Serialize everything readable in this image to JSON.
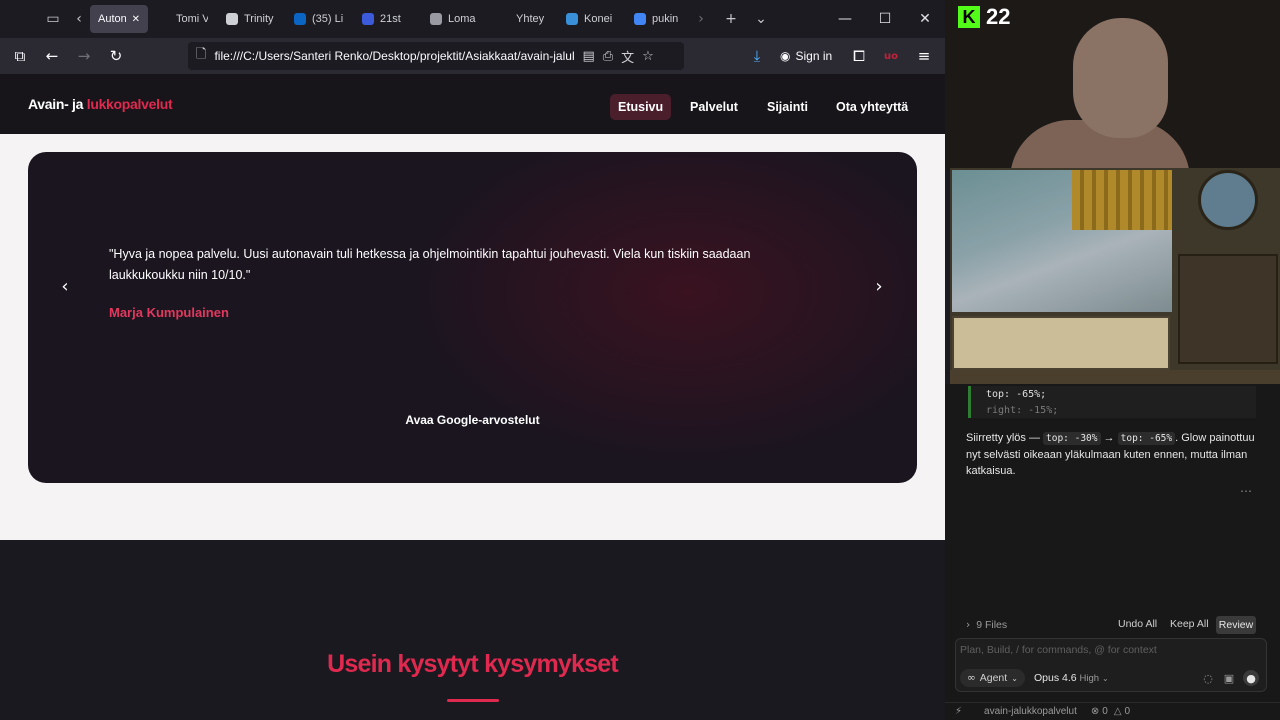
{
  "browser": {
    "tabs": [
      {
        "title": "Auton",
        "active": true,
        "favicon_color": "#6f6f78"
      },
      {
        "title": "Tomi Väli",
        "active": false,
        "favicon_color": "#1c1b22"
      },
      {
        "title": "Trinity",
        "active": false,
        "favicon_color": "#cfcfd6"
      },
      {
        "title": "(35) Li",
        "active": false,
        "favicon_color": "#0a66c2"
      },
      {
        "title": "21st",
        "active": false,
        "favicon_color": "#3b5bdb"
      },
      {
        "title": "Loma",
        "active": false,
        "favicon_color": "#9a9aa3"
      },
      {
        "title": "Yhtey",
        "active": false,
        "favicon_color": "#1c1b22"
      },
      {
        "title": "Konei",
        "active": false,
        "favicon_color": "#3a8fd9"
      },
      {
        "title": "pukin",
        "active": false,
        "favicon_color": "#4285f4"
      }
    ],
    "url": "file:///C:/Users/Santeri Renko/Desktop/projektit/Asiakkaat/avain-jaluk",
    "sign_in_label": "Sign in"
  },
  "site": {
    "logo_prefix": "Avain- ja ",
    "logo_accent": "lukkopalvelut",
    "menu": [
      {
        "label": "Etusivu",
        "active": true
      },
      {
        "label": "Palvelut",
        "active": false
      },
      {
        "label": "Sijainti",
        "active": false
      },
      {
        "label": "Ota yhteyttä",
        "active": false
      }
    ],
    "review": {
      "quote": "\"Hyva ja nopea palvelu. Uusi autonavain tuli hetkessa ja ohjelmointikin tapahtui jouhevasti. Viela kun tiskiin saadaan laukkukoukku niin 10/10.\"",
      "author": "Marja Kumpulainen",
      "google_link": "Avaa Google-arvostelut"
    },
    "faq_title": "Usein kysytyt kysymykset",
    "accent_color": "#e0294f"
  },
  "stream": {
    "kick_logo": "K",
    "viewer_count": "22"
  },
  "editor": {
    "code_lines": [
      "top: -65%;",
      "right: -15%;"
    ],
    "explain_prefix": "Siirretty ylös — ",
    "explain_code_from": "top: -30%",
    "explain_arrow": " → ",
    "explain_code_to": "top: -65%",
    "explain_suffix": ". Glow painottuu nyt selvästi oikeaan yläkulmaan kuten ennen, mutta ilman katkaisua.",
    "files_label": "9 Files",
    "undo_all": "Undo All",
    "keep_all": "Keep All",
    "review": "Review",
    "input_placeholder": "Plan, Build, / for commands, @ for context",
    "agent_label": "Agent",
    "model_label": "Opus 4.6",
    "model_level": "High",
    "status_project": "avain-jalukkopalvelut",
    "status_errors": "0",
    "status_warnings": "0"
  }
}
